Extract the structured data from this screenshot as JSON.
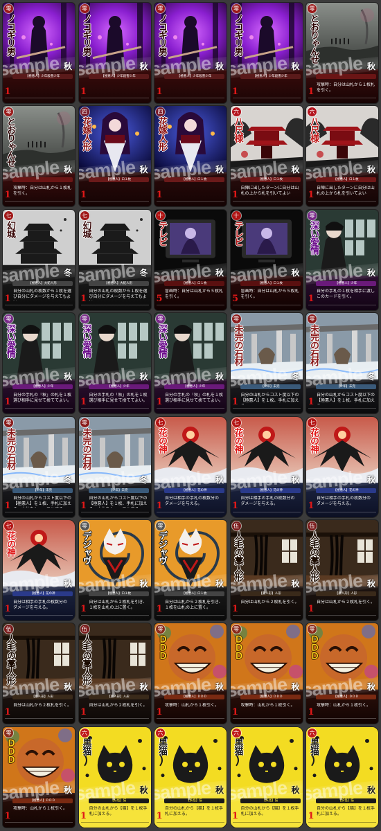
{
  "watermark": "sample",
  "cards": [
    {
      "theme": "purple",
      "art": "purple",
      "badge": "零",
      "title": "ノコギリ男",
      "season": "秋",
      "band": "【極悪人】少年殺害少年",
      "desc": "",
      "cost": "1"
    },
    {
      "theme": "purple",
      "art": "purple",
      "badge": "零",
      "title": "ノコギリ男",
      "season": "秋",
      "band": "【極悪人】少年殺害少年",
      "desc": "",
      "cost": "1"
    },
    {
      "theme": "purple",
      "art": "purple",
      "badge": "零",
      "title": "ノコギリ男",
      "season": "秋",
      "band": "【極悪人】少年殺害少年",
      "desc": "",
      "cost": "1"
    },
    {
      "theme": "purple",
      "art": "purple",
      "badge": "零",
      "title": "ノコギリ男",
      "season": "秋",
      "band": "【極悪人】少年殺害少年",
      "desc": "",
      "cost": "1"
    },
    {
      "theme": "fog",
      "art": "fog",
      "badge": "零",
      "title": "とおりゃんせ",
      "season": "秋",
      "band": "",
      "desc": "攻撃時：自分は山札から１枚札を引く。",
      "cost": "1"
    },
    {
      "theme": "fog",
      "art": "fog",
      "badge": "零",
      "title": "とおりゃんせ",
      "season": "秋",
      "band": "",
      "desc": "攻撃時：自分は山札から１枚札を引く。",
      "cost": "1"
    },
    {
      "theme": "doll",
      "art": "doll",
      "badge": "四",
      "title": "花嫁人形",
      "season": "秋",
      "band": "【極悪人】ロ１枚",
      "desc": "",
      "cost": "1"
    },
    {
      "theme": "doll",
      "art": "doll",
      "badge": "四",
      "title": "花嫁人形",
      "season": "秋",
      "band": "【極悪人】ロ１枚",
      "desc": "",
      "cost": "1"
    },
    {
      "theme": "shrine",
      "art": "shrine",
      "badge": "六",
      "title": "八尺様",
      "season": "秋",
      "band": "【極悪人】ロ１枚",
      "desc": "自陣に出したターンに自分は山札の上から札を引いてよい",
      "cost": "1"
    },
    {
      "theme": "shrine",
      "art": "shrine",
      "badge": "六",
      "title": "八尺様",
      "season": "秋",
      "band": "【極悪人】ロ１枚",
      "desc": "自陣に出したターンに自分は山札の上から札を引いてよい",
      "cost": "1"
    },
    {
      "theme": "castle",
      "art": "castle",
      "badge": "七",
      "title": "幻城",
      "season": "冬",
      "band": "【極悪人】大蛇人形",
      "desc": "自分の山札の枚数から１枚を選び自分にダメージを与えてもよい。",
      "cost": "1"
    },
    {
      "theme": "castle",
      "art": "castle",
      "badge": "七",
      "title": "幻城",
      "season": "冬",
      "band": "【極悪人】大蛇人形",
      "desc": "自分の山札の枚数から１枚を選び自分にダメージを与えてもよい。",
      "cost": "1"
    },
    {
      "theme": "tv",
      "art": "tv",
      "badge": "十",
      "title": "テレビ",
      "season": "秋",
      "band": "【極悪人】ロ１枚",
      "desc": "盲画時：自分は山札から５枚札を引く。",
      "cost": "5"
    },
    {
      "theme": "tv",
      "art": "tv",
      "badge": "十",
      "title": "テレビ",
      "season": "秋",
      "band": "【極悪人】ロ１枚",
      "desc": "盲画時：自分は山札から５枚札を引く。",
      "cost": "5"
    },
    {
      "theme": "love",
      "art": "love",
      "badge": "零",
      "title": "深い愛情",
      "season": "秋",
      "band": "【極悪人】少年",
      "desc": "自分の手札の１枚を相手に渡しこのカードを引く。",
      "cost": "1"
    },
    {
      "theme": "love",
      "art": "love",
      "badge": "零",
      "title": "深い愛情",
      "season": "秋",
      "band": "【極悪人】少年",
      "desc": "自分の手札の「秋」の札を１枚選び相手に見せて捨ててよい。",
      "cost": "1"
    },
    {
      "theme": "love",
      "art": "love",
      "badge": "零",
      "title": "深い愛情",
      "season": "秋",
      "band": "【極悪人】少年",
      "desc": "自分の手札の「秋」の札を１枚選び相手に見せて捨ててよい。",
      "cost": "1"
    },
    {
      "theme": "love",
      "art": "love",
      "badge": "零",
      "title": "深い愛情",
      "season": "秋",
      "band": "【極悪人】少年",
      "desc": "自分の手札の「秋」の札を１枚選び相手に見せて捨ててよい。",
      "cost": "1"
    },
    {
      "theme": "ruin",
      "art": "ruin",
      "badge": "零",
      "title": "未完の石材",
      "season": "冬",
      "band": "【少年】未完",
      "desc": "自分の山札からコスト度以下の【極悪人】を１枚、手札に加える。",
      "cost": "1"
    },
    {
      "theme": "ruin",
      "art": "ruin",
      "badge": "零",
      "title": "未完の石材",
      "season": "冬",
      "band": "【少年】未完",
      "desc": "自分の山札からコスト度以下の【極悪人】を１枚、手札に加える。",
      "cost": "1"
    },
    {
      "theme": "ruin",
      "art": "ruin",
      "badge": "零",
      "title": "未完の石材",
      "season": "冬",
      "band": "【少年】未完",
      "desc": "自分の山札からコスト度以下の【極悪人】を１枚、手札に加える。山札をシャッフルする。",
      "cost": "1"
    },
    {
      "theme": "ruin",
      "art": "ruin",
      "badge": "零",
      "title": "未完の石材",
      "season": "冬",
      "band": "【少年】未完",
      "desc": "自分の山札からコスト度以下の【極悪人】を１枚、手札に加える。山札をシャッフルする。",
      "cost": "1"
    },
    {
      "theme": "flower",
      "art": "flower",
      "badge": "七",
      "title": "花の神",
      "season": "秋",
      "band": "【極悪人】花の神",
      "desc": "自分は相手の手札の枚数分のダメージを与える。",
      "cost": "1"
    },
    {
      "theme": "flower",
      "art": "flower",
      "badge": "七",
      "title": "花の神",
      "season": "秋",
      "band": "【極悪人】花の神",
      "desc": "自分は相手の手札の枚数分のダメージを与える。",
      "cost": "1"
    },
    {
      "theme": "flower",
      "art": "flower",
      "badge": "七",
      "title": "花の神",
      "season": "秋",
      "band": "【極悪人】花の神",
      "desc": "自分は相手の手札の枚数分のダメージを与える。",
      "cost": "1"
    },
    {
      "theme": "flower",
      "art": "flower",
      "badge": "七",
      "title": "花の神",
      "season": "秋",
      "band": "【極悪人】花の神",
      "desc": "自分は相手の手札の枚数分のダメージを与える。",
      "cost": "1"
    },
    {
      "theme": "fox",
      "art": "fox",
      "badge": "零",
      "title": "デジャヴ",
      "season": "秋",
      "band": "【極悪人】ロ１枚",
      "desc": "自分は山札から２枚札を引き、１枚を山札の上に置く。",
      "cost": "1"
    },
    {
      "theme": "fox",
      "art": "fox",
      "badge": "零",
      "title": "デジャヴ",
      "season": "秋",
      "band": "【極悪人】ロ１枚",
      "desc": "自分は山札から２枚札を引き、１枚を山札の上に置く。",
      "cost": "1"
    },
    {
      "theme": "hair",
      "art": "hair",
      "badge": "伍",
      "title": "人毛の藁人形",
      "season": "秋",
      "band": "【藁人形】人形",
      "desc": "自分は山札から２枚札を引く。",
      "cost": "1"
    },
    {
      "theme": "hair",
      "art": "hair",
      "badge": "伍",
      "title": "人毛の藁人形",
      "season": "秋",
      "band": "【藁人形】人形",
      "desc": "自分は山札から２枚札を引く。",
      "cost": "1"
    },
    {
      "theme": "hair",
      "art": "hair",
      "badge": "伍",
      "title": "人毛の藁人形",
      "season": "秋",
      "band": "【藁人形】人形",
      "desc": "自分は山札から２枚札を引く。",
      "cost": "1"
    },
    {
      "theme": "hair",
      "art": "hair",
      "badge": "伍",
      "title": "人毛の藁人形",
      "season": "秋",
      "band": "【藁人形】人形",
      "desc": "自分は山札から２枚札を引く。",
      "cost": "1"
    },
    {
      "theme": "ddd",
      "art": "ddd",
      "badge": "零",
      "title": "ＤＤＤ",
      "season": "秋",
      "band": "【極悪人】ＤＤＤ",
      "desc": "攻撃時：山札から１枚引く。",
      "cost": "1"
    },
    {
      "theme": "ddd",
      "art": "ddd",
      "badge": "零",
      "title": "ＤＤＤ",
      "season": "秋",
      "band": "【極悪人】ＤＤＤ",
      "desc": "攻撃時：山札から１枚引く。",
      "cost": "1"
    },
    {
      "theme": "ddd",
      "art": "ddd",
      "badge": "零",
      "title": "ＤＤＤ",
      "season": "秋",
      "band": "【極悪人】ＤＤＤ",
      "desc": "攻撃時：山札から１枚引く。",
      "cost": "1"
    },
    {
      "theme": "ddd",
      "art": "ddd",
      "badge": "零",
      "title": "ＤＤＤ",
      "season": "秋",
      "band": "【極悪人】ＤＤＤ",
      "desc": "攻撃時：山札から１枚引く。",
      "cost": "1"
    },
    {
      "theme": "yellow",
      "art": "yellow",
      "badge": "六",
      "title": "黒猫",
      "season": "秋",
      "band": "【妖怪】猫",
      "desc": "自分の山札から【猫】を１枚手札に加える。",
      "cost": "1"
    },
    {
      "theme": "yellow",
      "art": "yellow",
      "badge": "六",
      "title": "黒猫",
      "season": "秋",
      "band": "【妖怪】猫",
      "desc": "自分の山札から【猫】を１枚手札に加える。",
      "cost": "1"
    },
    {
      "theme": "yellow",
      "art": "yellow",
      "badge": "六",
      "title": "黒猫",
      "season": "秋",
      "band": "【妖怪】猫",
      "desc": "自分の山札から【猫】を１枚手札に加える。",
      "cost": "1"
    },
    {
      "theme": "yellow",
      "art": "yellow",
      "badge": "六",
      "title": "黒猫",
      "season": "秋",
      "band": "【妖怪】猫",
      "desc": "自分の山札から【猫】を１枚手札に加える。",
      "cost": "1"
    }
  ]
}
